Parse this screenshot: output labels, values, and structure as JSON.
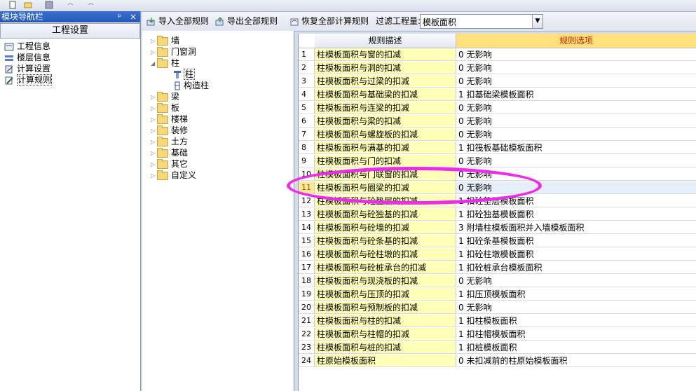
{
  "nav": {
    "title": "模块导航栏",
    "pin_glyph": "ᵖ",
    "close_glyph": "×",
    "tab_label": "工程设置",
    "items": [
      {
        "label": "工程信息",
        "icon": "project-info-icon"
      },
      {
        "label": "楼层信息",
        "icon": "floor-info-icon"
      },
      {
        "label": "计算设置",
        "icon": "calc-settings-icon"
      },
      {
        "label": "计算规则",
        "icon": "calc-rules-icon"
      }
    ]
  },
  "toolbar": {
    "import_label": "导入全部规则",
    "export_label": "导出全部规则",
    "restore_label": "恢复全部计算规则",
    "filter_label": "过滤工程量:",
    "filter_value": "模板面积"
  },
  "tree": {
    "items": [
      {
        "label": "墙",
        "expanded": false
      },
      {
        "label": "门窗洞",
        "expanded": false
      },
      {
        "label": "柱",
        "expanded": true
      },
      {
        "label": "柱",
        "child": true
      },
      {
        "label": "构造柱",
        "child": true
      },
      {
        "label": "梁",
        "expanded": false
      },
      {
        "label": "板",
        "expanded": false
      },
      {
        "label": "楼梯",
        "expanded": false
      },
      {
        "label": "装修",
        "expanded": false
      },
      {
        "label": "土方",
        "expanded": false
      },
      {
        "label": "基础",
        "expanded": false
      },
      {
        "label": "其它",
        "expanded": false
      },
      {
        "label": "自定义",
        "expanded": false
      }
    ]
  },
  "grid": {
    "header_desc": "规则描述",
    "header_opt": "规则选项",
    "rows": [
      {
        "no": "1",
        "desc": "柱模板面积与窗的扣减",
        "opt": "0   无影响"
      },
      {
        "no": "2",
        "desc": "柱模板面积与洞的扣减",
        "opt": "0   无影响"
      },
      {
        "no": "3",
        "desc": "柱模板面积与过梁的扣减",
        "opt": "0   无影响"
      },
      {
        "no": "4",
        "desc": "柱模板面积与基础梁的扣减",
        "opt": "1  扣基础梁模板面积"
      },
      {
        "no": "5",
        "desc": "柱模板面积与连梁的扣减",
        "opt": "0   无影响"
      },
      {
        "no": "6",
        "desc": "柱模板面积与梁的扣减",
        "opt": "0   无影响"
      },
      {
        "no": "7",
        "desc": "柱模板面积与螺旋板的扣减",
        "opt": "0   无影响"
      },
      {
        "no": "8",
        "desc": "柱模板面积与满基的扣减",
        "opt": "1  扣筏板基础模板面积"
      },
      {
        "no": "9",
        "desc": "柱模板面积与门的扣减",
        "opt": "0   无影响"
      },
      {
        "no": "10",
        "desc": "柱模板面积与门联窗的扣减",
        "opt": "0   无影响"
      },
      {
        "no": "11",
        "desc": "柱模板面积与圈梁的扣减",
        "opt": "0   无影响"
      },
      {
        "no": "12",
        "desc": "柱模板面积与砼垫层的扣减",
        "opt": "1  扣砼垫层模板面积"
      },
      {
        "no": "13",
        "desc": "柱模板面积与砼独基的扣减",
        "opt": "1  扣砼独基模板面积"
      },
      {
        "no": "14",
        "desc": "柱模板面积与砼墙的扣减",
        "opt": "3  附墙柱模板面积并入墙模板面积"
      },
      {
        "no": "15",
        "desc": "柱模板面积与砼条基的扣减",
        "opt": "1  扣砼条基模板面积"
      },
      {
        "no": "16",
        "desc": "柱模板面积与砼柱墩的扣减",
        "opt": "1  扣砼柱墩模板面积"
      },
      {
        "no": "17",
        "desc": "柱模板面积与砼桩承台的扣减",
        "opt": "1  扣砼桩承台模板面积"
      },
      {
        "no": "18",
        "desc": "柱模板面积与现浇板的扣减",
        "opt": "0   无影响"
      },
      {
        "no": "19",
        "desc": "柱模板面积与压顶的扣减",
        "opt": "1  扣压顶模板面积"
      },
      {
        "no": "20",
        "desc": "柱模板面积与预制板的扣减",
        "opt": "0   无影响"
      },
      {
        "no": "21",
        "desc": "柱模板面积与柱的扣减",
        "opt": "1  扣柱模板面积"
      },
      {
        "no": "22",
        "desc": "柱模板面积与柱帽的扣减",
        "opt": "1  扣柱帽模板面积"
      },
      {
        "no": "23",
        "desc": "柱模板面积与桩的扣减",
        "opt": "1  扣桩模板面积"
      },
      {
        "no": "24",
        "desc": "柱原始模板面积",
        "opt": "0  未扣减前的柱原始模板面积"
      }
    ]
  },
  "colors": {
    "accent_header_opt": "#cc2200",
    "desc_bg": "#ffffb8",
    "highlight_ring": "#ee2bea"
  }
}
